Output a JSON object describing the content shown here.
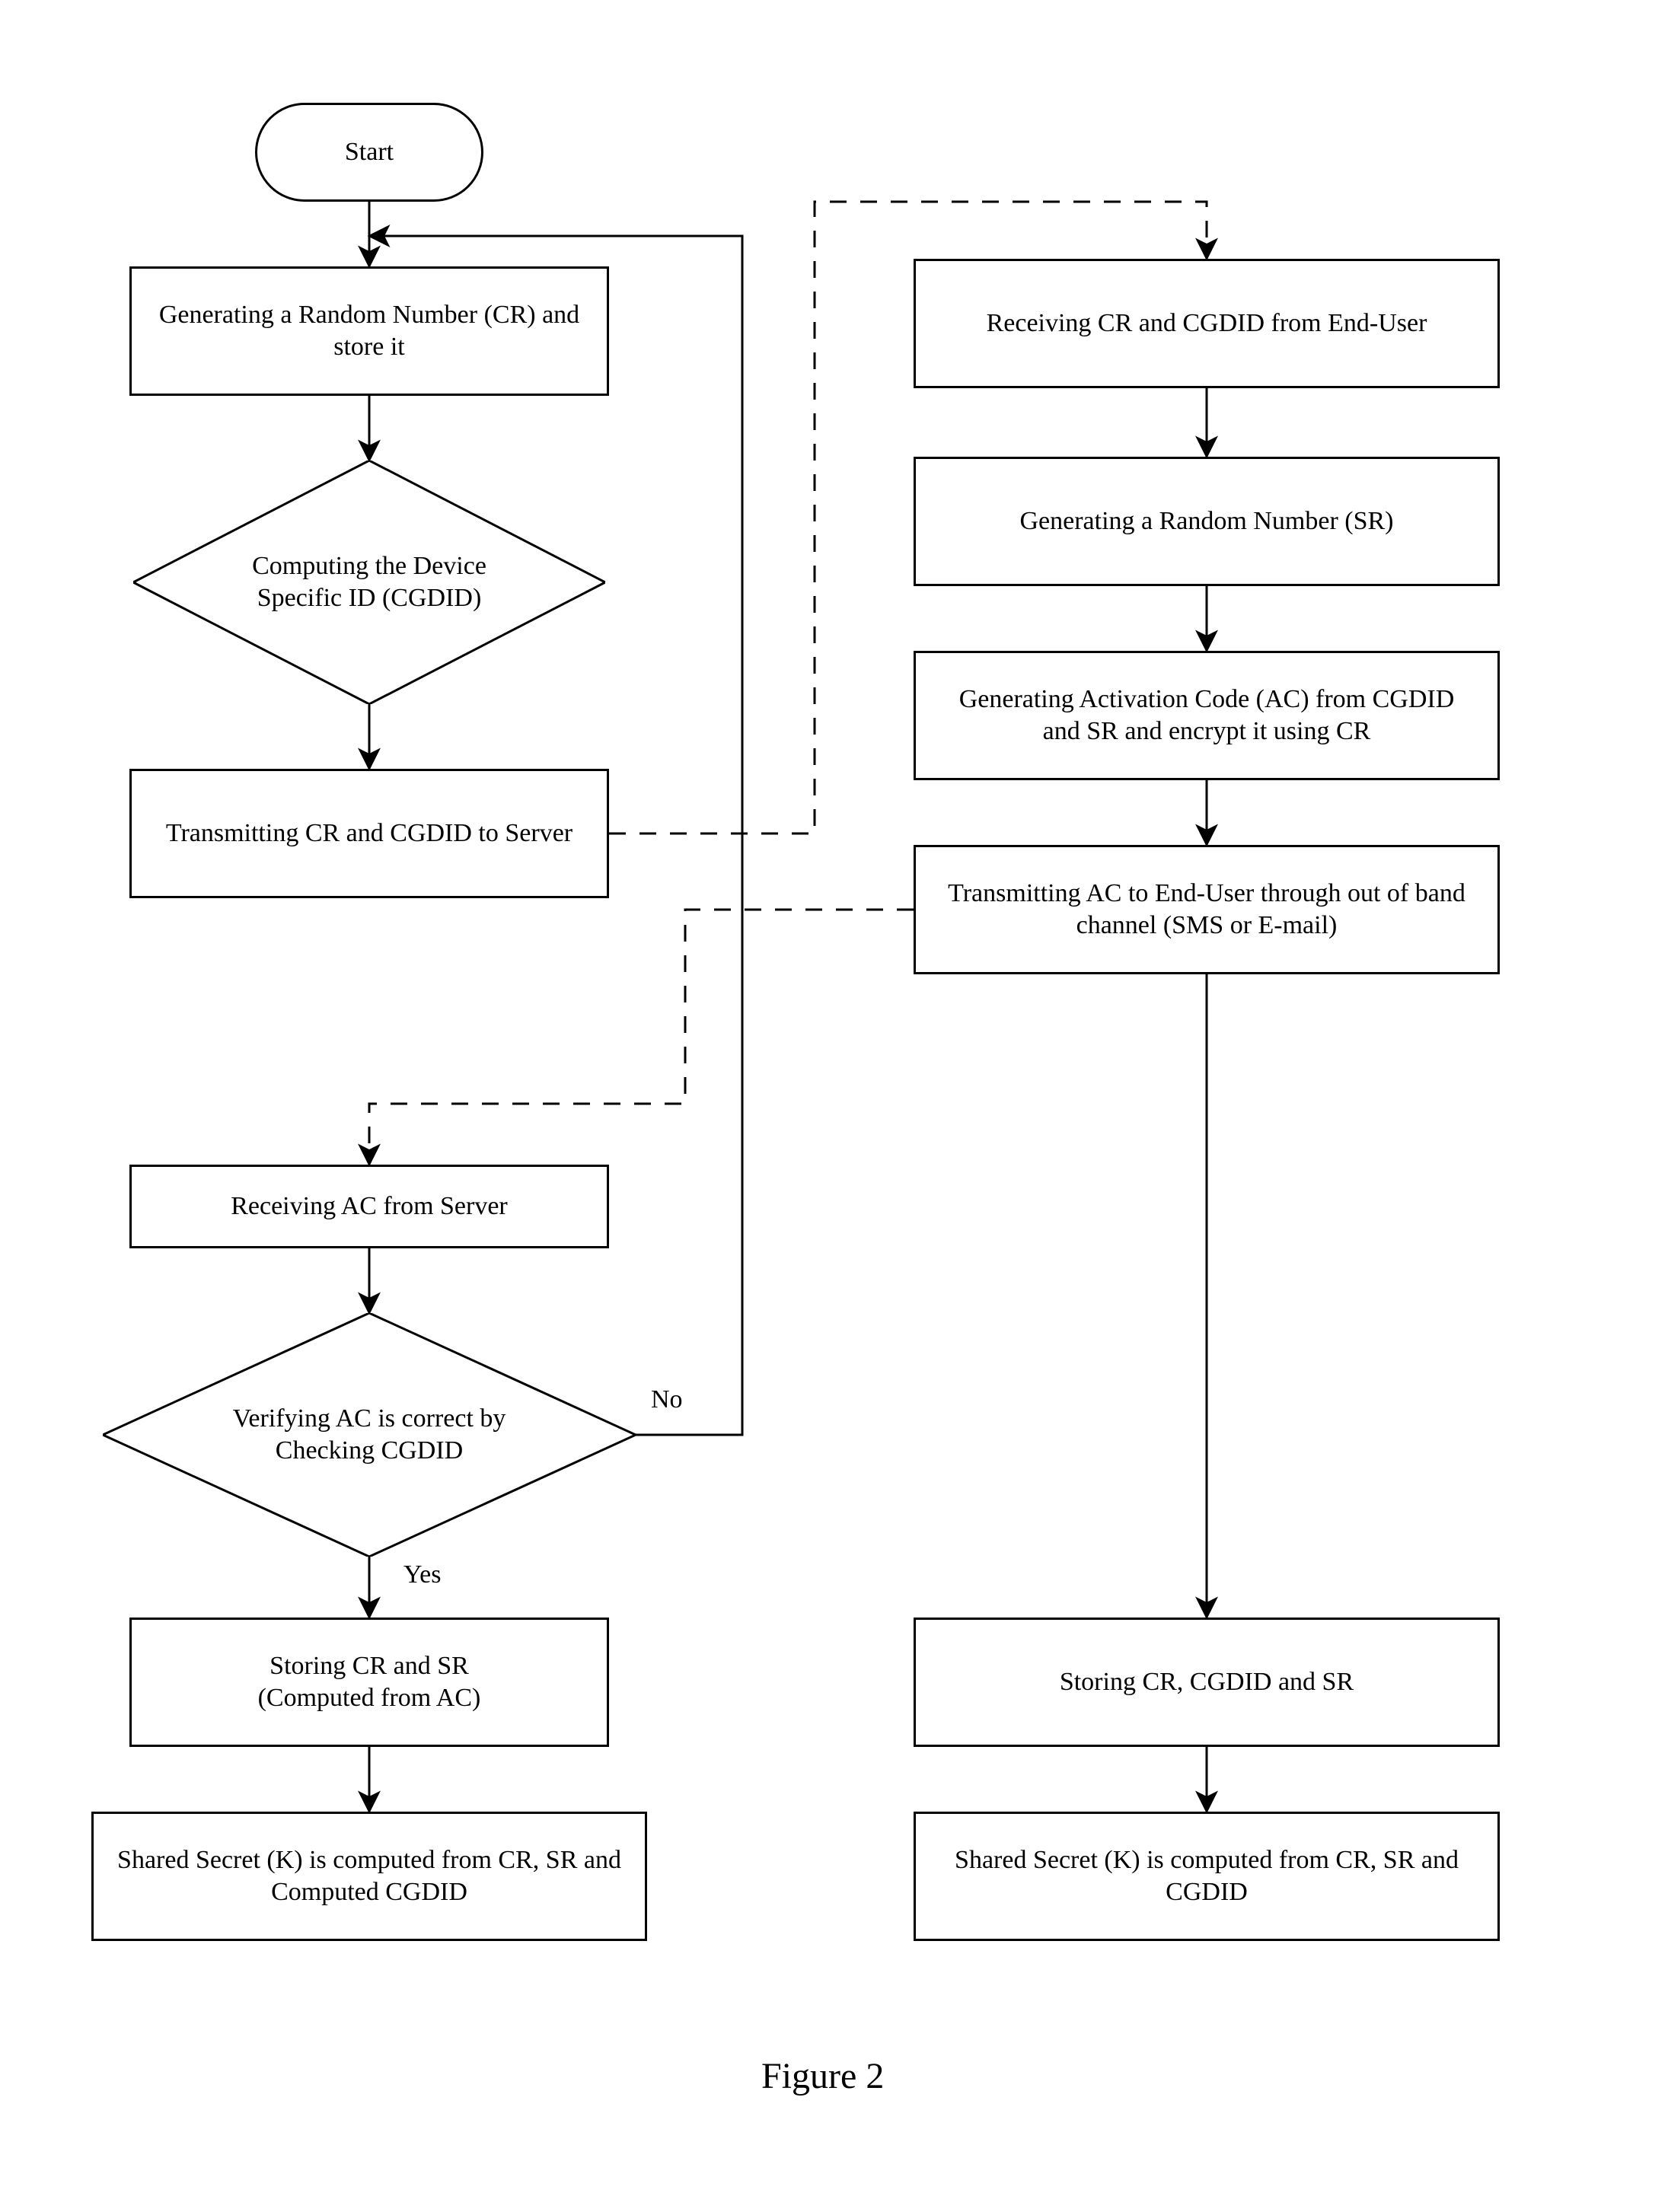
{
  "caption": "Figure 2",
  "nodes": {
    "start": "Start",
    "gen_cr": "Generating a Random Number (CR) and store it",
    "compute_id": "Computing the Device Specific ID (CGDID)",
    "transmit_to_server": "Transmitting CR and CGDID to Server",
    "receive_ac": "Receiving AC from Server",
    "verify_ac": "Verifying AC is correct by Checking CGDID",
    "store_cr_sr_client": "Storing CR and SR\n(Computed from AC)",
    "shared_secret_client": "Shared Secret (K) is computed from CR, SR and Computed CGDID",
    "recv_from_user": "Receiving CR and CGDID from End-User",
    "gen_sr": "Generating a Random Number (SR)",
    "gen_ac": "Generating Activation Code (AC) from CGDID and SR and encrypt it using CR",
    "transmit_ac_oob": "Transmitting AC to End-User through out of band channel (SMS or E-mail)",
    "store_server": "Storing CR, CGDID and SR",
    "shared_secret_server": "Shared Secret (K) is computed from CR, SR and CGDID"
  },
  "branch_labels": {
    "yes": "Yes",
    "no": "No"
  }
}
